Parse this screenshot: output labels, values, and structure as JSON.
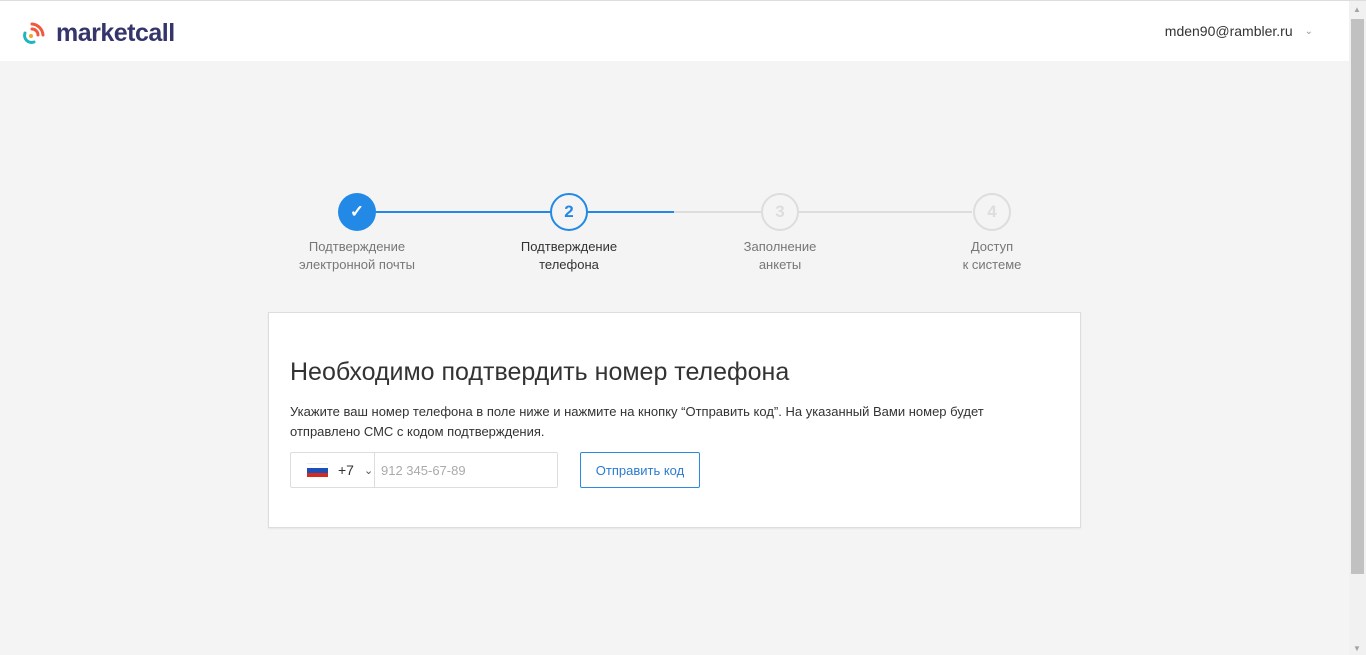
{
  "header": {
    "logo_text": "marketcall",
    "user_email": "mden90@rambler.ru"
  },
  "stepper": {
    "progress_percent": 50,
    "steps": [
      {
        "number": "1",
        "line1": "Подтверждение",
        "line2": "электронной почты",
        "state": "done"
      },
      {
        "number": "2",
        "line1": "Подтверждение",
        "line2": "телефона",
        "state": "active"
      },
      {
        "number": "3",
        "line1": "Заполнение",
        "line2": "анкеты",
        "state": "pending"
      },
      {
        "number": "4",
        "line1": "Доступ",
        "line2": "к системе",
        "state": "pending"
      }
    ]
  },
  "card": {
    "title": "Необходимо подтвердить номер телефона",
    "description": "Укажите ваш номер телефона в поле ниже и нажмите на кнопку “Отправить код”. На указанный Вами номер будет отправлено СМС с кодом подтверждения.",
    "country_code": "+7",
    "phone_placeholder": "912 345-67-89",
    "phone_value": "",
    "send_button": "Отправить код"
  },
  "colors": {
    "accent": "#2289e6",
    "pending": "#dddddd",
    "logo_text": "#35346b"
  }
}
